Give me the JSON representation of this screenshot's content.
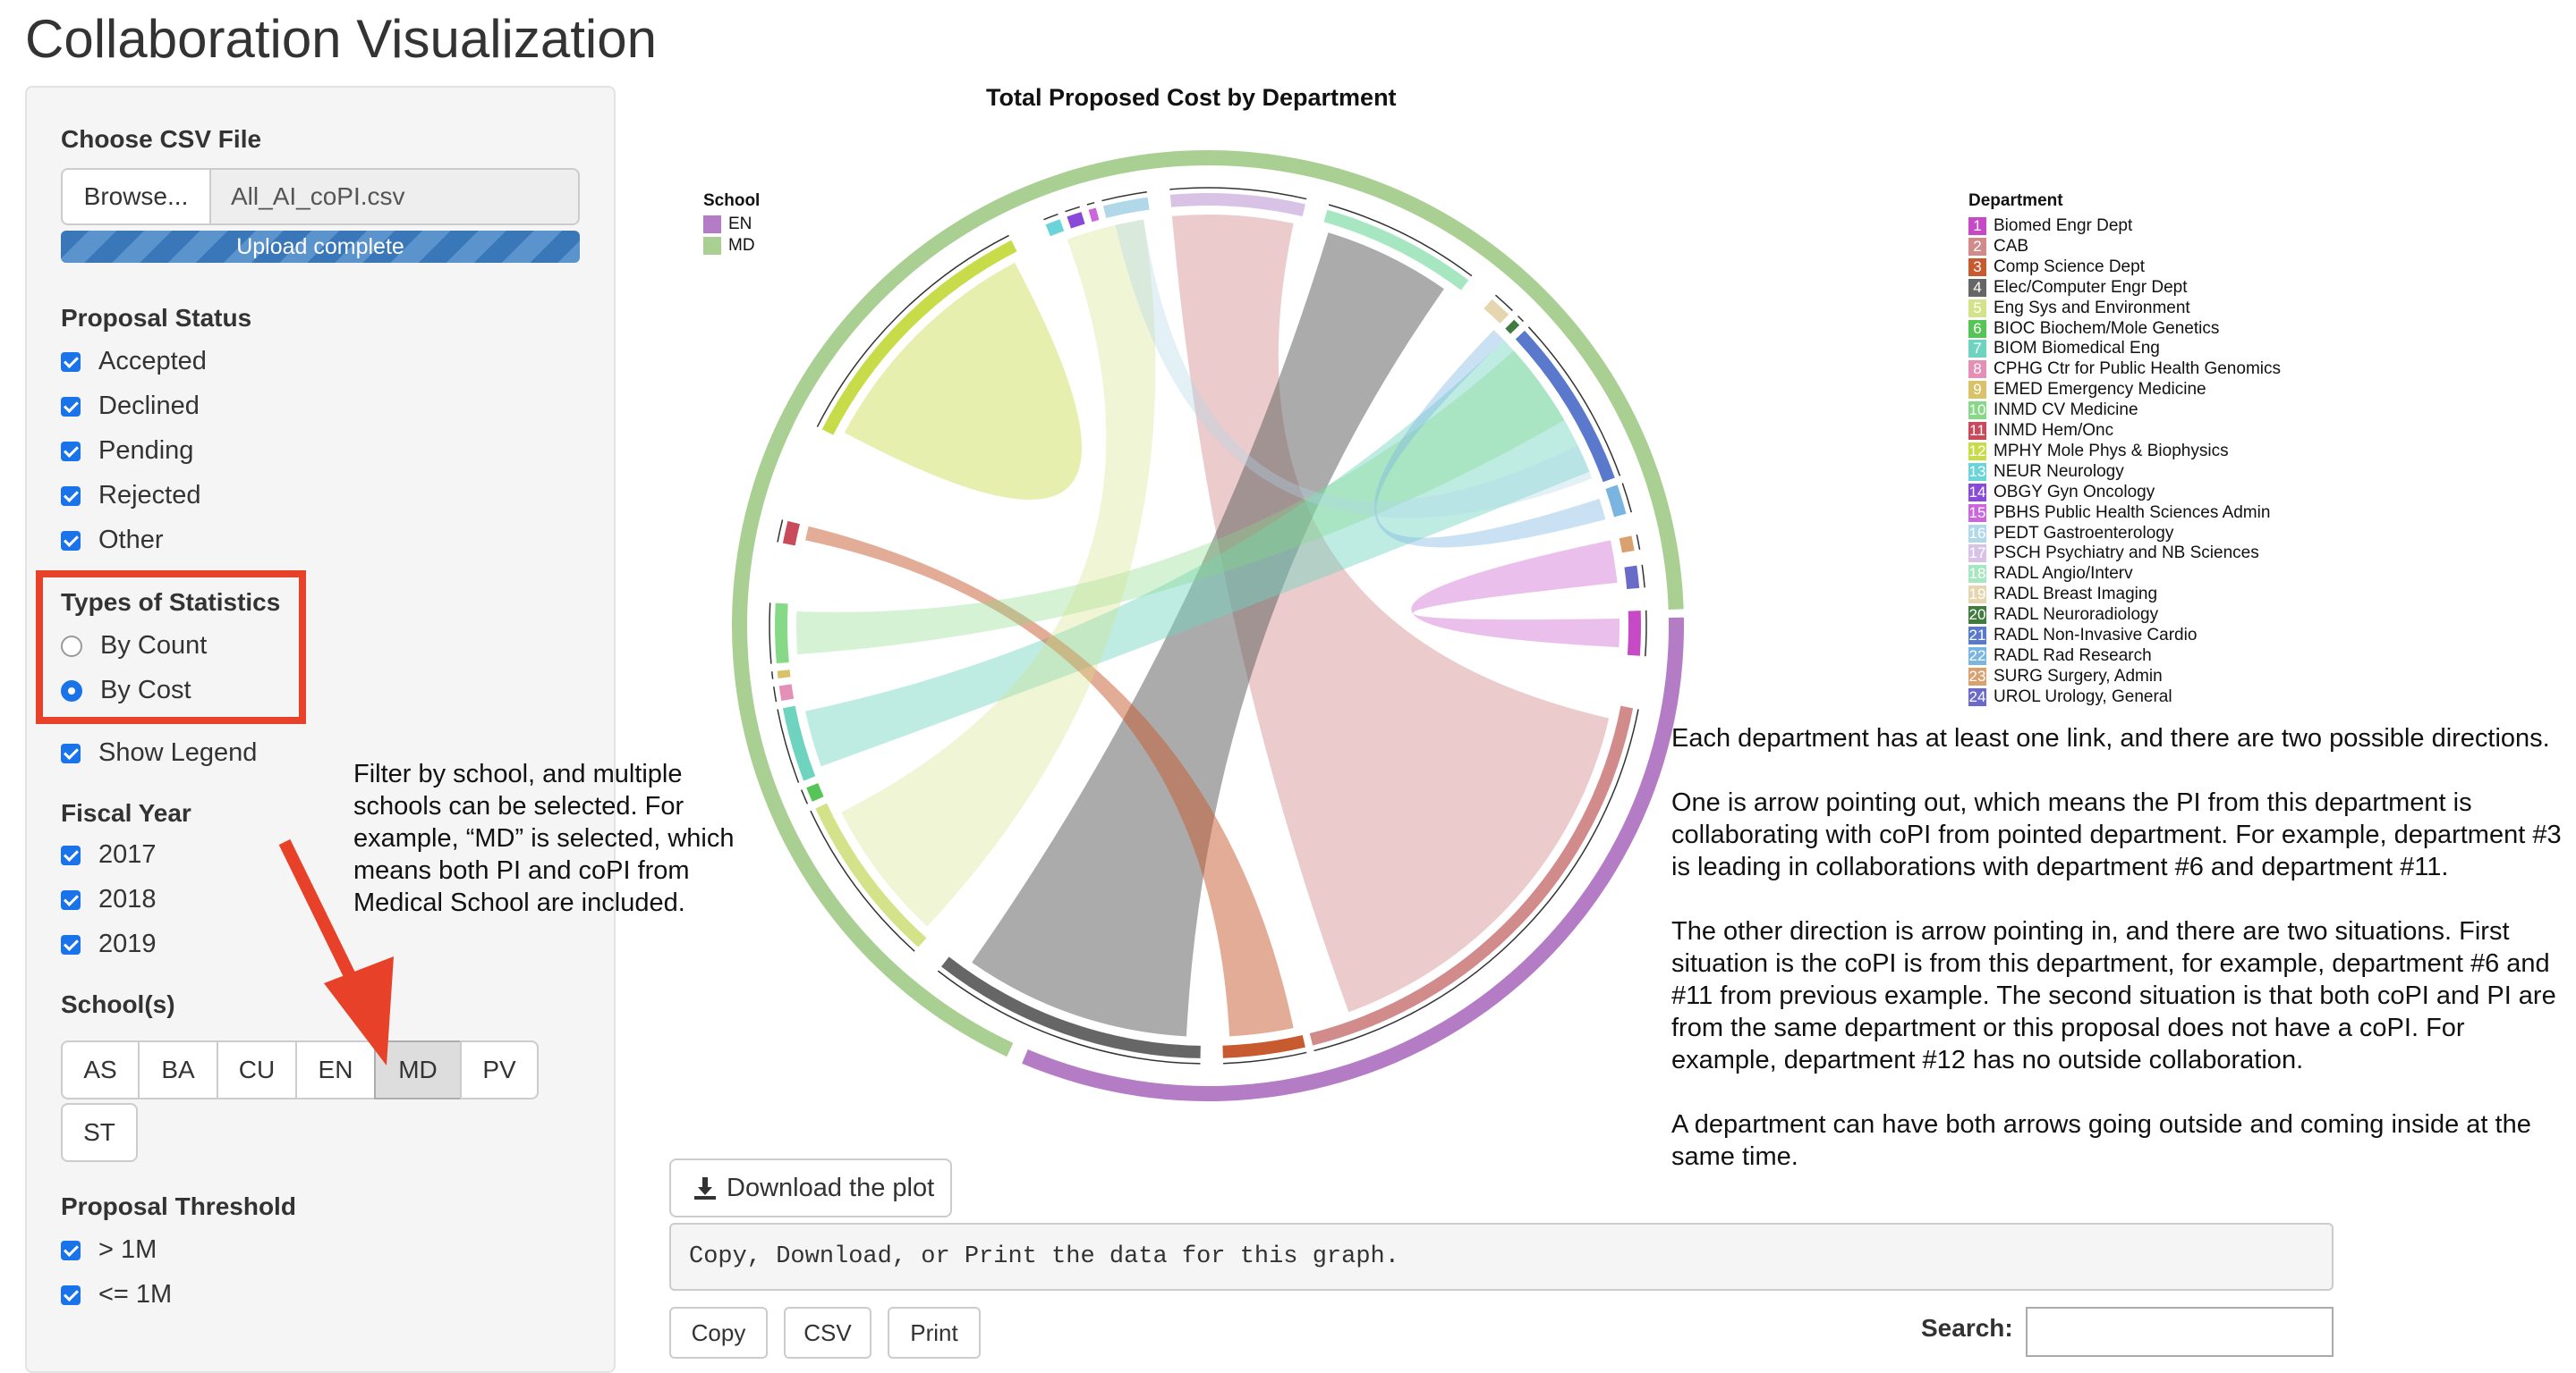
{
  "app": {
    "title": "Collaboration Visualization"
  },
  "sidebar": {
    "file": {
      "label": "Choose CSV File",
      "browse": "Browse...",
      "filename": "All_AI_coPI.csv",
      "progress": "Upload complete",
      "progress_value": 1.0
    },
    "proposal_status": {
      "label": "Proposal Status",
      "options": [
        {
          "label": "Accepted",
          "checked": true
        },
        {
          "label": "Declined",
          "checked": true
        },
        {
          "label": "Pending",
          "checked": true
        },
        {
          "label": "Rejected",
          "checked": true
        },
        {
          "label": "Other",
          "checked": true
        }
      ]
    },
    "stats": {
      "label": "Types of Statistics",
      "options": [
        {
          "label": "By Count",
          "selected": false
        },
        {
          "label": "By Cost",
          "selected": true
        }
      ]
    },
    "show_legend": {
      "label": "Show Legend",
      "checked": true
    },
    "fiscal_year": {
      "label": "Fiscal Year",
      "options": [
        {
          "label": "2017",
          "checked": true
        },
        {
          "label": "2018",
          "checked": true
        },
        {
          "label": "2019",
          "checked": true
        }
      ]
    },
    "schools": {
      "label": "School(s)",
      "buttons": [
        "AS",
        "BA",
        "CU",
        "EN",
        "MD",
        "PV",
        "ST"
      ],
      "active": "MD"
    },
    "threshold": {
      "label": "Proposal Threshold",
      "options": [
        {
          "label": "> 1M",
          "checked": true
        },
        {
          "label": "<= 1M",
          "checked": true
        }
      ]
    }
  },
  "annotation": {
    "filter_note": "Filter by school, and multiple schools can be selected. For example, “MD” is selected, which means both PI and coPI from Medical School are included."
  },
  "chart": {
    "title": "Total Proposed Cost by Department",
    "school_legend_title": "School",
    "schools": [
      {
        "name": "EN",
        "color": "#b57cc6"
      },
      {
        "name": "MD",
        "color": "#a9cf92"
      }
    ],
    "department_legend_title": "Department",
    "departments": [
      {
        "num": "1",
        "name": "Biomed Engr Dept",
        "color": "#c649c6"
      },
      {
        "num": "2",
        "name": "CAB",
        "color": "#d28b8b"
      },
      {
        "num": "3",
        "name": "Comp Science Dept",
        "color": "#c85a30"
      },
      {
        "num": "4",
        "name": "Elec/Computer Engr Dept",
        "color": "#666666"
      },
      {
        "num": "5",
        "name": "Eng Sys and Environment",
        "color": "#d4e38a"
      },
      {
        "num": "6",
        "name": "BIOC Biochem/Mole Genetics",
        "color": "#56c456"
      },
      {
        "num": "7",
        "name": "BIOM Biomedical Eng",
        "color": "#6ed4c0"
      },
      {
        "num": "8",
        "name": "CPHG Ctr for Public Health Genomics",
        "color": "#e48fb6"
      },
      {
        "num": "9",
        "name": "EMED Emergency Medicine",
        "color": "#d9c36a"
      },
      {
        "num": "10",
        "name": "INMD CV Medicine",
        "color": "#86d986"
      },
      {
        "num": "11",
        "name": "INMD Hem/Onc",
        "color": "#c94a5a"
      },
      {
        "num": "12",
        "name": "MPHY Mole Phys & Biophysics",
        "color": "#c8dc4a"
      },
      {
        "num": "13",
        "name": "NEUR Neurology",
        "color": "#6ad4d9"
      },
      {
        "num": "14",
        "name": "OBGY Gyn Oncology",
        "color": "#8a4ad9"
      },
      {
        "num": "15",
        "name": "PBHS Public Health Sciences Admin",
        "color": "#cc66dd"
      },
      {
        "num": "16",
        "name": "PEDT Gastroenterology",
        "color": "#b0d8e8"
      },
      {
        "num": "17",
        "name": "PSCH Psychiatry and NB Sciences",
        "color": "#d8c2e6"
      },
      {
        "num": "18",
        "name": "RADL Angio/Interv",
        "color": "#a6e6c0"
      },
      {
        "num": "19",
        "name": "RADL Breast Imaging",
        "color": "#e6d6b0"
      },
      {
        "num": "20",
        "name": "RADL Neuroradiology",
        "color": "#3f7a3f"
      },
      {
        "num": "21",
        "name": "RADL Non-Invasive Cardio",
        "color": "#5a78cc"
      },
      {
        "num": "22",
        "name": "RADL Rad Research",
        "color": "#7ab4e0"
      },
      {
        "num": "23",
        "name": "SURG Surgery, Admin",
        "color": "#d9a070"
      },
      {
        "num": "24",
        "name": "UROL Urology, General",
        "color": "#6a6ac8"
      }
    ]
  },
  "description": {
    "p1": "Each department has at least one link, and there are two possible directions.",
    "p2": "One is arrow pointing out, which means the PI from this department is collaborating with coPI from pointed department. For example, department #3 is leading in collaborations with department #6 and department #11.",
    "p3": "The other direction is arrow pointing in, and there are two situations. First situation is the coPI is from this department, for example, department #6 and #11 from previous example. The second situation is that both coPI and PI are from the same department or this proposal does not have a coPI. For example, department #12 has no outside collaboration.",
    "p4": "A department can have both arrows going outside and coming inside at the same time."
  },
  "bottom": {
    "download": "Download the plot",
    "code_text": "Copy, Download, or Print the data for this graph.",
    "copy": "Copy",
    "csv": "CSV",
    "print": "Print",
    "search_label": "Search:"
  }
}
